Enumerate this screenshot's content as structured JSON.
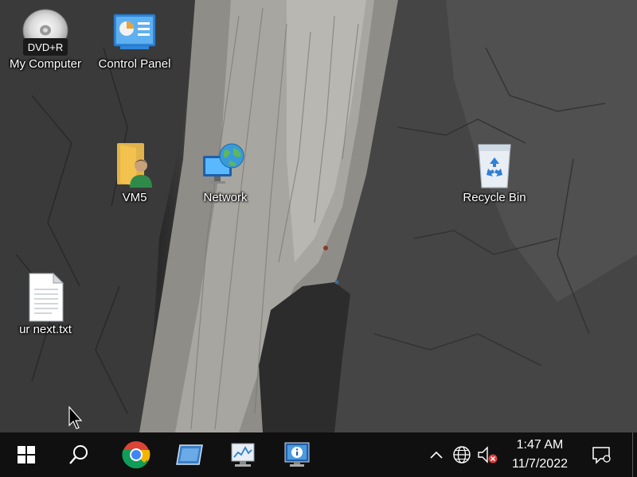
{
  "desktop": {
    "icons": [
      {
        "label": "My Computer",
        "badge": "DVD+R",
        "icon": "dvd-drive-icon"
      },
      {
        "label": "Control Panel",
        "icon": "control-panel-icon"
      },
      {
        "label": "VM5",
        "icon": "user-folder-icon"
      },
      {
        "label": "Network",
        "icon": "network-globe-icon"
      },
      {
        "label": "Recycle Bin",
        "icon": "recycle-bin-icon"
      },
      {
        "label": "ur next.txt",
        "icon": "text-file-icon"
      }
    ]
  },
  "taskbar": {
    "start_icon": "windows-logo-icon",
    "search_icon": "search-icon",
    "pinned": [
      {
        "name": "Google Chrome",
        "icon": "chrome-icon"
      },
      {
        "name": "Window Switcher",
        "icon": "window-icon"
      },
      {
        "name": "Performance Monitor",
        "icon": "monitor-chart-icon"
      },
      {
        "name": "System Information",
        "icon": "system-info-icon"
      }
    ],
    "tray": {
      "chevron_icon": "chevron-up-icon",
      "network_icon": "globe-icon",
      "volume_icon": "speaker-muted-icon"
    },
    "clock": {
      "time": "1:47 AM",
      "date": "11/7/2022"
    },
    "action_center_icon": "notification-icon"
  },
  "colors": {
    "taskbar_bg": "#101010",
    "icon_text": "#ffffff",
    "folder_yellow": "#f2c14e",
    "accent_blue": "#2f7fd6"
  }
}
